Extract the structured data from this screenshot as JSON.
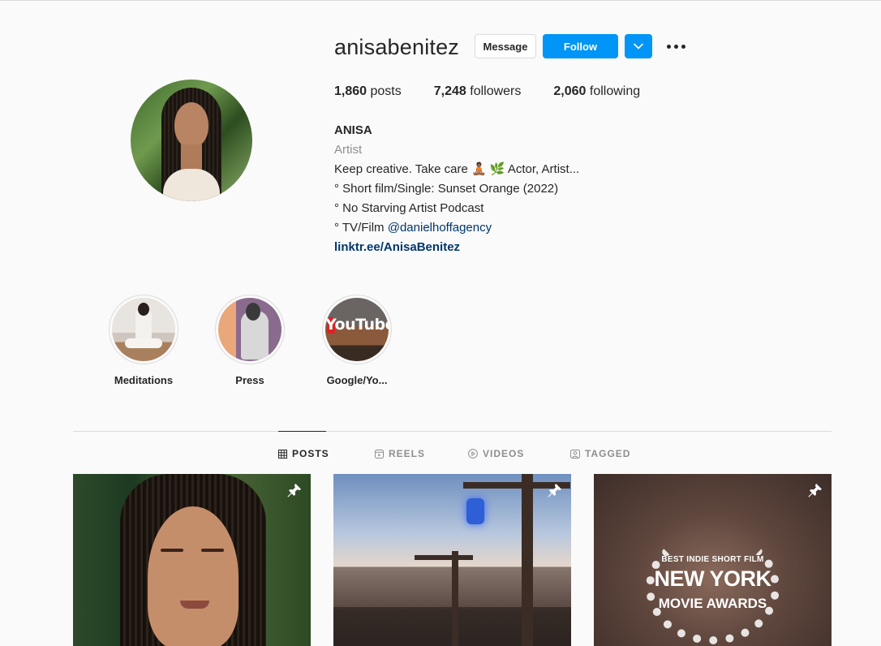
{
  "profile": {
    "username": "anisabenitez",
    "message_label": "Message",
    "follow_label": "Follow",
    "stats": {
      "posts_count": "1,860",
      "posts_label": "posts",
      "followers_count": "7,248",
      "followers_label": "followers",
      "following_count": "2,060",
      "following_label": "following"
    },
    "bio": {
      "name": "ANISA",
      "category": "Artist",
      "line1": "Keep creative. Take care 🧘🏾 🌿 Actor, Artist...",
      "line2": "° Short film/Single: Sunset Orange (2022)",
      "line3": "° No Starving Artist Podcast",
      "line4_prefix": "° TV/Film ",
      "line4_mention": "@danielhoffagency",
      "link": "linktr.ee/AnisaBenitez"
    }
  },
  "highlights": [
    {
      "label": "Meditations"
    },
    {
      "label": "Press"
    },
    {
      "label": "Google/Yo..."
    }
  ],
  "highlight_youtube_text": "YouTube",
  "tabs": [
    {
      "label": "POSTS",
      "icon": "grid-icon",
      "active": true
    },
    {
      "label": "REELS",
      "icon": "reels-icon",
      "active": false
    },
    {
      "label": "VIDEOS",
      "icon": "play-circle-icon",
      "active": false
    },
    {
      "label": "TAGGED",
      "icon": "tagged-icon",
      "active": false
    }
  ],
  "posts": [
    {
      "pinned": true,
      "pin_icon": "pin-icon"
    },
    {
      "pinned": true,
      "pin_icon": "pin-icon"
    },
    {
      "pinned": true,
      "pin_icon": "pin-icon",
      "overlay_line1": "BEST INDIE SHORT FILM",
      "overlay_line2": "NEW YORK",
      "overlay_line3": "MOVIE AWARDS"
    }
  ],
  "colors": {
    "primary_blue": "#0095f6",
    "link_blue": "#00376b",
    "secondary_text": "#8e8e8e",
    "text": "#262626",
    "background": "#fafafa"
  }
}
